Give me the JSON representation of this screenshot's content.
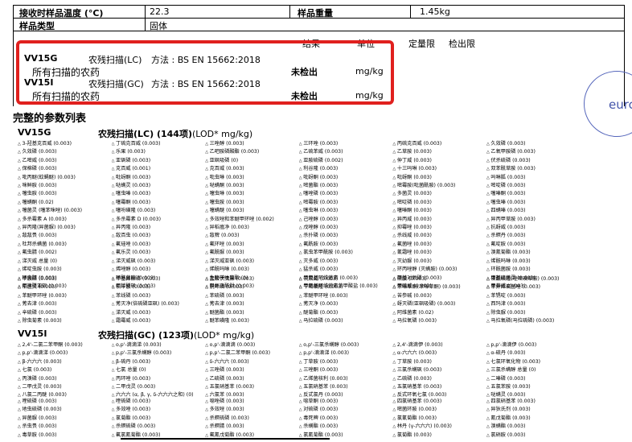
{
  "header_table": {
    "row1": {
      "label": "接收时样品温度 (°C)",
      "value": "22.3",
      "label2": "样品重量",
      "value2": "1.45kg"
    },
    "row2": {
      "label": "样品类型",
      "value": "固体"
    }
  },
  "results_header": {
    "col_result": "结果",
    "col_unit": "单位",
    "col_limit": "定量限",
    "col_detection": "检出限"
  },
  "results": [
    {
      "code": "VV15G",
      "name": "农残扫描(LC)",
      "method": "方法 : BS EN 15662:2018",
      "sub": "所有扫描的农药",
      "result": "未检出",
      "unit": "mg/kg"
    },
    {
      "code": "VV15I",
      "name": "农残扫描(GC)",
      "method": "方法 : BS EN 15662:2018",
      "sub": "所有扫描的农药",
      "result": "未检出",
      "unit": "mg/kg"
    }
  ],
  "param_title": "完整的参数列表",
  "lc": {
    "code": "VV15G",
    "title": "农残扫描(LC) (144项)",
    "lod": "(LOD* mg/kg)"
  },
  "gc": {
    "code": "VV15I",
    "title": "农残扫描(GC) (123项)",
    "lod": "(LOD* mg/kg)"
  },
  "seal_text": "eurc",
  "lc_block1": [
    "3-羟基克百威 (0.003)",
    "丁硫克百威 (0.003)",
    "三唑醇 (0.003)",
    "三环唑 (0.003)",
    "丙硫克百威 (0.003)",
    "久效磷 (0.003)",
    "久效磷 (0.003)",
    "乐果 (0.003)",
    "乙吧胺磷酸酯 (0.003)",
    "乙硫苯威 (0.003)",
    "乙草胺 (0.003)",
    "乙氧甲胺磷 (0.003)",
    "乙嘧威 (0.003)",
    "亚砜磷 (0.003)",
    "亚砜吸磷 (0)",
    "亚胺硫磷 (0.002)",
    "仲丁威 (0.003)",
    "伏杀硫磷 (0.003)",
    "保棉磷 (0.003)",
    "克百威 (0.001)",
    "克百威 (0.003)",
    "利谷隆 (0.003)",
    "十三吗啉 (0.003)",
    "双苯酰草胺 (0.003)",
    "吡丙醚(蚊蝇醚) (0.003)",
    "吡蚜酮 (0.003)",
    "吡虫啉 (0.003)",
    "吡蚜酮 (0.003)",
    "吡蚜酮 (0.003)",
    "吗啉胍 (0.003)",
    "咪鲜胺 (0.003)",
    "哒螨灵 (0.003)",
    "哒螨酮 (0.003)",
    "嘧菌酯 (0.003)",
    "嘧霉胺(吡菌酰胺) (0.003)",
    "嘧啶磷 (0.003)",
    "噻虫胺 (0.003)",
    "噻虫嗪 (0.003)",
    "噻虫啉 (0.003)",
    "噻唑磷 (0.003)",
    "多菌灵 (0.003)",
    "噻嗪酮 (0.003)",
    "噻螨酮 (0.02)",
    "噻霉酮 (0.003)",
    "噻虫胺 (0.003)",
    "嘧霉胺 (0.003)",
    "嘧啶磷 (0.003)",
    "噻虫嗪 (0.003)",
    "噻菌灵 (噻苯咪唑) (0.003)",
    "噻吩磺隆 (0.003)",
    "噻螨醚 (0.003)",
    "噻虫啉 (0.003)",
    "噻嗪酮 (0.003)",
    "四螨嗪 (0.003)",
    "多杀霉素 A (0.003)",
    "多杀霉素 D (0.003)",
    "多效唑和苯醚甲环唑 (0.002)",
    "己唑醇 (0.003)",
    "异丙威 (0.003)",
    "异丙甲草胺 (0.003)",
    "异丙隆(异菌脲) (0.003)",
    "异丙隆 (0.003)",
    "异稻瘟净 (0.003)",
    "戊唑醇 (0.003)",
    "抑霉唑 (0.003)",
    "抗蚜威 (0.003)",
    "敌敌畏 (0.003)",
    "敌百虫 (0.003)",
    "敌稗 (0.003)",
    "杀扑磷 (0.003)",
    "杀线威 (0.003)",
    "杀螟丹 (0.003)",
    "杜邦杀螨菌 (0.003)",
    "氟硅唑 (0.003)",
    "氟环唑 (0.003)",
    "氟酰胺 (0.003)",
    "氟菌唑 (0.003)",
    "氟啶胺 (0.003)",
    "氟虫腈 (0.002)",
    "氟乐灵 (0.003)",
    "氟酰脲 (0.003)",
    "氯虫苯甲酰胺 (0.003)",
    "氰霜唑 (0.003)",
    "溴氰菊酯 (0.003)",
    "涕灭威 总量 (0)",
    "涕灭威砜 (0.003)",
    "涕灭威亚砜 (0.003)",
    "灭多威 (0.003)",
    "灭幼脲 (0.003)",
    "烯酰吗啉 (0.003)",
    "烯啶虫胺 (0.003)",
    "烯唑醇 (0.003)",
    "烯酰吗啉 (0.003)",
    "猛杀威 (0.003)",
    "环丙唑醇 (灭螨胺) (0.003)",
    "环酰菌胺 (0.003)",
    "环虫腈 (0.003)",
    "环酰菌胺 (0.003)",
    "生物苄呋菊酯 (0)",
    "甲氨基阿维菌素 (0.003)",
    "甲基对氧磷 (0.003)",
    "甲基硫菌灵 (0.003)",
    "甲拌磷亚砜 (0.003)",
    "甲拌磷砜 (0.003)",
    "甲氧虫酰肼 (0.003)",
    "甲氨基阿维菌素苯甲酸盐 (0.003)",
    "甲硫威 (0.003)",
    "甲萘威 (0.003)"
  ],
  "lc_block2": [
    "甲胺磷 (0.003)",
    "甲基异柳磷 (0.003)",
    "盐酸伏虫脒 (0.003)",
    "硫双威 (0.003)",
    "磷胺 (0.003)",
    "磺酰磺隆(唑嘧磺草胺) (0.003)",
    "稻瘟灵 (0.003)",
    "稻丰散 (0.003)",
    "脱叶磷 (0.003)",
    "苄嘧磺隆 (0.003)",
    "苯嗪草酮(苯嗪草酮) (0.003)",
    "苯并烯氟菌唑 (0.003)",
    "苯醚甲环唑 (0.003)",
    "苯线磷 (0.003)",
    "苯硫磷 (0.003)",
    "苯醚甲环唑 (0.003)",
    "苦参碱 (0.003)",
    "苯锈啶 (0.003)",
    "莠去津 (0.003)",
    "莠灭净(倍硫磷亚砜) (0.003)",
    "莠去津 (0.003)",
    "莠灭净 (0.003)",
    "蚜灭磷(亚砜吸磷) (0.003)",
    "西玛津 (0.003)",
    "辛硫磷 (0.003)",
    "涕灭威 (0.003)",
    "醚菌酯 (0.003)",
    "醚菊酯 (0.003)",
    "阿维菌素 (0.02)",
    "除虫脲 (0.003)",
    "除虫菊素 (0.003)",
    "霜霉威 (0.003)",
    "醚苯磺隆 (0.003)",
    "马拉硫磷 (0.003)",
    "马拉氧磷 (0.003)",
    "马拉氧磷(马拉硫磷) (0.003)"
  ],
  "gc_block1": [
    "2,4'-二氯二苯甲酮 (0.003)",
    "o,p'-滴滴涕 (0.003)",
    "o,p'-滴滴滴 (0.003)",
    "o,p'-三氯杀螨醇 (0.003)",
    "2,4'-滴滴伊 (0.003)",
    "p,p'-滴滴伊 (0.003)",
    "p,p'-滴滴涕 (0.003)",
    "p,p'-三氯杀螨醇 (0.003)",
    "p,p'-二氯二苯甲酮 (0.003)",
    "p,p'-滴滴涕 (0.003)",
    "α-六六六 (0.003)",
    "α-硫丹 (0.003)",
    "β-六六六 (0.003)",
    "β-硫丹 (0.003)",
    "δ-六六六 (0.003)",
    "丁草胺 (0.003)",
    "丁草胺 (0.003)",
    "七氯环氧化物 (0.003)",
    "七氯 (0.003)",
    "七氯 总量 (0)",
    "三唑磷 (0.003)",
    "三唑酮 (0.003)",
    "三氯杀螨砜 (0.003)",
    "三氯杀螨醇 总量 (0)",
    "丙溴磷 (0.003)",
    "丙环唑 (0.003)",
    "乙硫磷 (0.003)",
    "乙烯菌核利 (0.003)",
    "乙硫磷 (0.003)",
    "二嗪磷 (0.003)",
    "二甲戊灵 (0.003)",
    "二甲戊灵 (0.003)",
    "五氯硝基苯 (0.003)",
    "五氯硝基苯 (0.003)",
    "五氯硝基苯 (0.003)",
    "五氯苯胺 (0.003)",
    "八氯二丙醚 (0.003)",
    "六六六 (α, β, γ, δ-六六六之和) (0)",
    "六氯苯 (0.003)",
    "反式氯丹 (0.003)",
    "反式环氧七氯 (0.003)",
    "哒螨灵 (0.003)"
  ],
  "gc_block2": [
    "喹硫磷 (0.003)",
    "喹硫磷 (0.003)",
    "噁唑磷 (0.003)",
    "噁草酮 (0.003)",
    "四氯硝基苯 (0.003)",
    "四氯硝基苯 (0.003)",
    "地虫硫磷 (0.003)",
    "多效唑 (0.003)",
    "多效唑 (0.003)",
    "对硫磷 (0.003)",
    "嘧菌环胺 (0.003)",
    "异狄氏剂 (0.003)",
    "异菌脲 (0.003)",
    "氯菊酯 (0.003)",
    "杀螟硫磷 (0.003)",
    "毒死蜱 (0.003)",
    "氯氰菊酯 (0.003)",
    "氰戊菊酯 (0.003)",
    "杀虫畏 (0.003)",
    "杀螟硫磷 (0.003)",
    "杀螟腈 (0.003)",
    "杀螨酯 (0.003)",
    "林丹 (γ-六六六) (0.003)",
    "溴螨酯 (0.003)",
    "毒草胺 (0.003)",
    "氟氯氰菊酯 (0.003)",
    "氟氰戊菊酯 (0.003)",
    "氯氰菊酯 (0.003)",
    "氯菊酯 (0.003)",
    "氯硝胺 (0.003)"
  ]
}
